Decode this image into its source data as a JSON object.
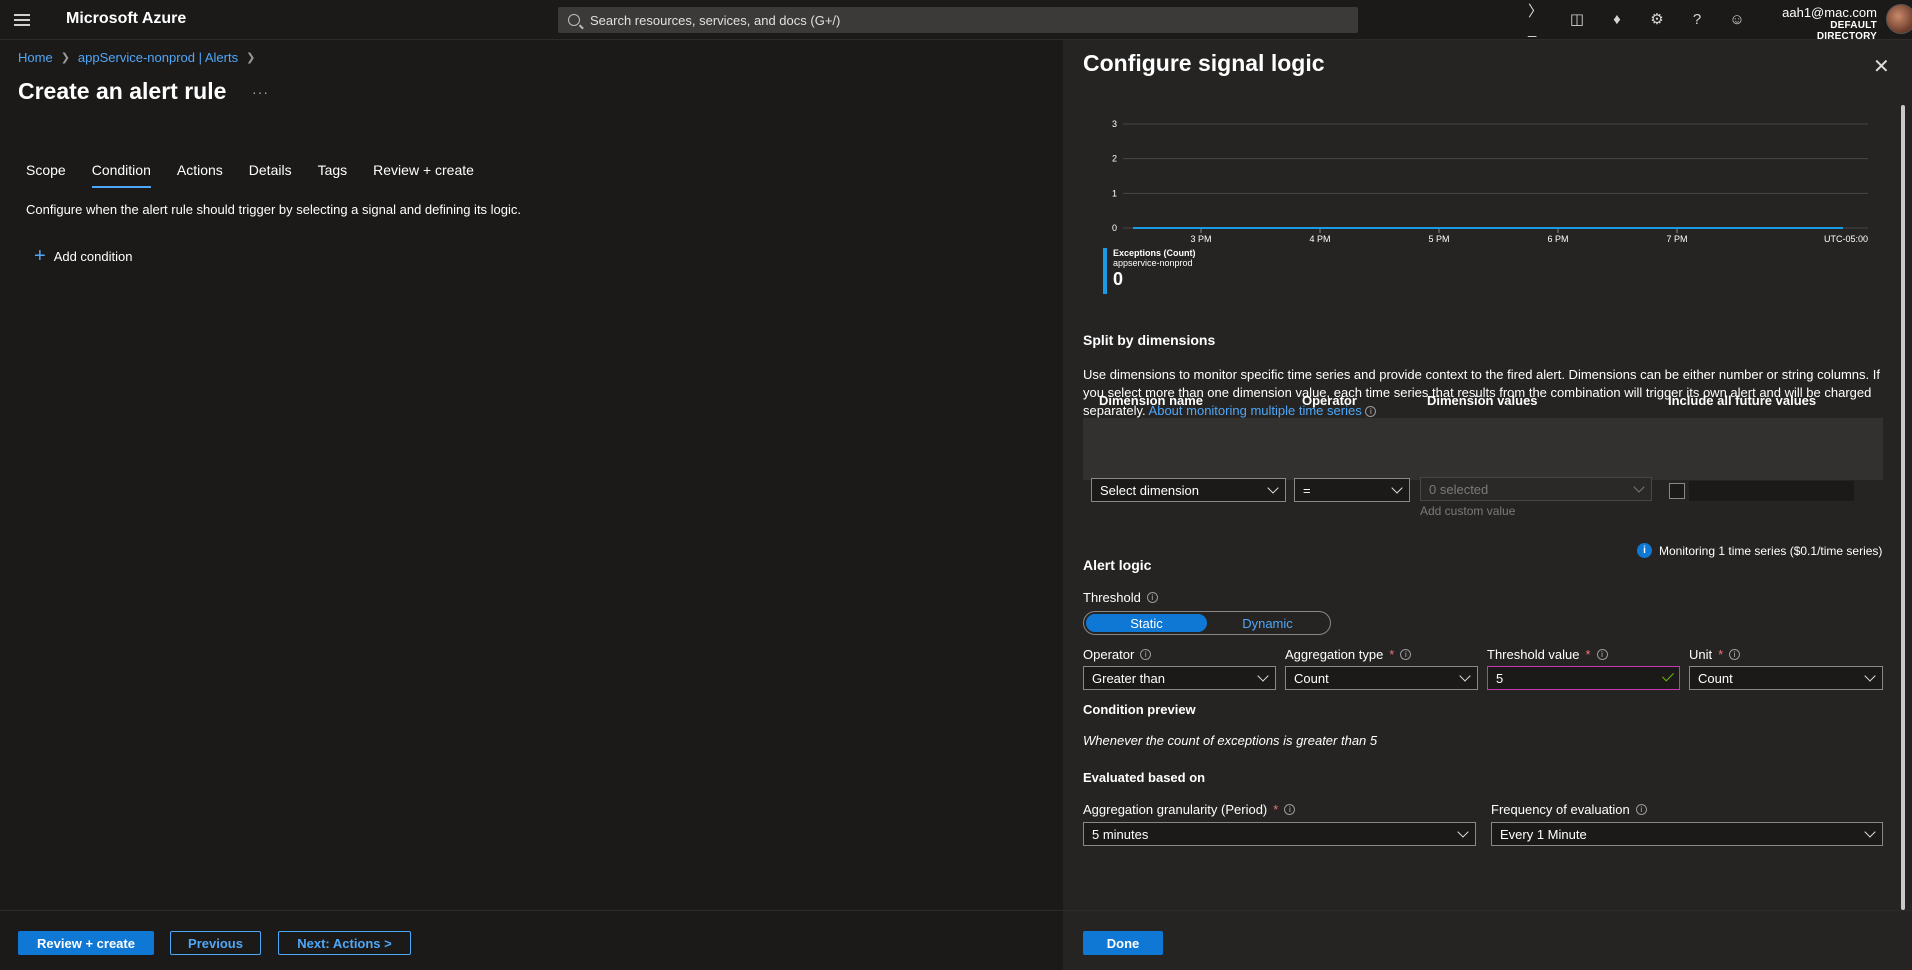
{
  "topbar": {
    "brand": "Microsoft Azure",
    "search_placeholder": "Search resources, services, and docs (G+/)",
    "icons": [
      "cloud-shell-icon",
      "directory-filter-icon",
      "notifications-icon",
      "settings-icon",
      "help-icon",
      "feedback-icon"
    ],
    "account_email": "aah1@mac.com",
    "account_directory": "DEFAULT DIRECTORY"
  },
  "breadcrumb": [
    "Home",
    "appService-nonprod | Alerts"
  ],
  "page": {
    "title": "Create an alert rule",
    "tabs": [
      "Scope",
      "Condition",
      "Actions",
      "Details",
      "Tags",
      "Review + create"
    ],
    "active_tab": "Condition",
    "description": "Configure when the alert rule should trigger by selecting a signal and defining its logic.",
    "add_condition": "Add condition"
  },
  "footer": {
    "review_create": "Review + create",
    "previous": "Previous",
    "next": "Next: Actions >"
  },
  "panel": {
    "title": "Configure signal logic",
    "done": "Done"
  },
  "chart_data": {
    "type": "line",
    "x": [
      "3 PM",
      "4 PM",
      "5 PM",
      "6 PM",
      "7 PM"
    ],
    "yticks": [
      "0",
      "1",
      "2",
      "3"
    ],
    "ylim": [
      0,
      3
    ],
    "timezone": "UTC-05:00",
    "series": [
      {
        "name": "Exceptions (Count)",
        "values": [
          0,
          0,
          0,
          0,
          0
        ],
        "color": "#1a9be8"
      }
    ],
    "legend": {
      "metric": "Exceptions (Count)",
      "resource": "appservice-nonprod",
      "value": "0"
    }
  },
  "split": {
    "heading": "Split by dimensions",
    "text": "Use dimensions to monitor specific time series and provide context to the fired alert. Dimensions can be either number or string columns. If you select more than one dimension value, each time series that results from the combination will trigger its own alert and will be charged separately.",
    "link": "About monitoring multiple time series",
    "columns": {
      "name": "Dimension name",
      "operator": "Operator",
      "values": "Dimension values",
      "future": "Include all future values"
    },
    "row": {
      "name": "Select dimension",
      "operator": "=",
      "values": "0 selected",
      "add_custom": "Add custom value"
    }
  },
  "monitor_note": "Monitoring 1 time series ($0.1/time series)",
  "alert_logic": {
    "heading": "Alert logic",
    "threshold_label": "Threshold",
    "threshold_options": [
      "Static",
      "Dynamic"
    ],
    "threshold_selected": "Static",
    "operator_label": "Operator",
    "operator_value": "Greater than",
    "aggregation_label": "Aggregation type",
    "aggregation_value": "Count",
    "threshold_value_label": "Threshold value",
    "threshold_value": "5",
    "unit_label": "Unit",
    "unit_value": "Count",
    "preview_heading": "Condition preview",
    "preview_text": "Whenever the count of exceptions is greater than 5"
  },
  "evaluation": {
    "heading": "Evaluated based on",
    "granularity_label": "Aggregation granularity (Period)",
    "granularity_value": "5 minutes",
    "frequency_label": "Frequency of evaluation",
    "frequency_value": "Every 1 Minute"
  }
}
